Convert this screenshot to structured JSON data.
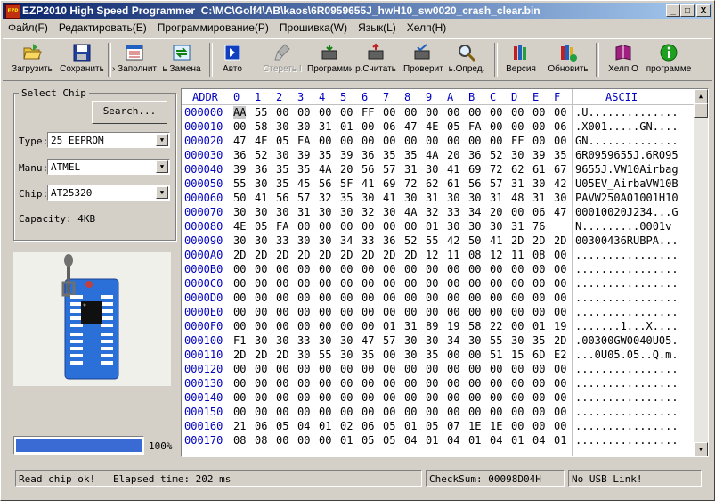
{
  "titlebar": {
    "app_name": "EZP2010 High Speed Programmer",
    "file_path": "C:\\MC\\Golf4\\AB\\kaos\\6R0959655J_hwH10_sw0020_crash_clear.bin",
    "minimize": "_",
    "maximize": "□",
    "close": "X"
  },
  "menu": [
    {
      "label": "Файл(F)"
    },
    {
      "label": "Редактировать(E)"
    },
    {
      "label": "Программирование(P)"
    },
    {
      "label": "Прошивка(W)"
    },
    {
      "label": "Язык(L)"
    },
    {
      "label": "Хелп(H)"
    }
  ],
  "toolbar": {
    "load": "Загрузить",
    "save": "Сохранить",
    "fill": "› Заполнит",
    "swap": "ь Замена",
    "auto": "Авто",
    "erase": "Стереть I",
    "program": "Программи",
    "read": "р.Считать",
    "verify": ".Проверит",
    "detect": "ь.Опред.",
    "version": "Версия",
    "update": "Обновить",
    "help": "Хелп О",
    "about": "программе"
  },
  "select_chip": {
    "legend": "Select Chip",
    "search_button": "Search...",
    "type_label": "Type:",
    "type_value": "25 EEPROM",
    "manu_label": "Manu:",
    "manu_value": "ATMEL",
    "chip_label": "Chip:",
    "chip_value": "AT25320",
    "capacity": "Capacity: 4KB"
  },
  "progress": {
    "value_fraction": 1.0,
    "percent_label": "100%"
  },
  "hex": {
    "addr_header": "ADDR",
    "ascii_header": "ASCII",
    "columns": [
      "0",
      "1",
      "2",
      "3",
      "4",
      "5",
      "6",
      "7",
      "8",
      "9",
      "A",
      "B",
      "C",
      "D",
      "E",
      "F"
    ],
    "rows": [
      {
        "addr": "000000",
        "bytes": [
          "AA",
          "55",
          "00",
          "00",
          "00",
          "00",
          "FF",
          "00",
          "00",
          "00",
          "00",
          "00",
          "00",
          "00",
          "00",
          "00"
        ],
        "ascii": ".U.............."
      },
      {
        "addr": "000010",
        "bytes": [
          "00",
          "58",
          "30",
          "30",
          "31",
          "01",
          "00",
          "06",
          "47",
          "4E",
          "05",
          "FA",
          "00",
          "00",
          "00",
          "06"
        ],
        "ascii": ".X001.....GN...."
      },
      {
        "addr": "000020",
        "bytes": [
          "47",
          "4E",
          "05",
          "FA",
          "00",
          "00",
          "00",
          "00",
          "00",
          "00",
          "00",
          "00",
          "00",
          "FF",
          "00",
          "00"
        ],
        "ascii": "GN.............."
      },
      {
        "addr": "000030",
        "bytes": [
          "36",
          "52",
          "30",
          "39",
          "35",
          "39",
          "36",
          "35",
          "35",
          "4A",
          "20",
          "36",
          "52",
          "30",
          "39",
          "35"
        ],
        "ascii": "6R0959655J.6R095"
      },
      {
        "addr": "000040",
        "bytes": [
          "39",
          "36",
          "35",
          "35",
          "4A",
          "20",
          "56",
          "57",
          "31",
          "30",
          "41",
          "69",
          "72",
          "62",
          "61",
          "67"
        ],
        "ascii": "9655J.VW10Airbag"
      },
      {
        "addr": "000050",
        "bytes": [
          "55",
          "30",
          "35",
          "45",
          "56",
          "5F",
          "41",
          "69",
          "72",
          "62",
          "61",
          "56",
          "57",
          "31",
          "30",
          "42"
        ],
        "ascii": "U05EV_AirbaVW10B"
      },
      {
        "addr": "000060",
        "bytes": [
          "50",
          "41",
          "56",
          "57",
          "32",
          "35",
          "30",
          "41",
          "30",
          "31",
          "30",
          "30",
          "31",
          "48",
          "31",
          "30"
        ],
        "ascii": "PAVW250A01001H10"
      },
      {
        "addr": "000070",
        "bytes": [
          "30",
          "30",
          "30",
          "31",
          "30",
          "30",
          "32",
          "30",
          "4A",
          "32",
          "33",
          "34",
          "20",
          "00",
          "06",
          "47"
        ],
        "ascii": "00010020J234...G"
      },
      {
        "addr": "000080",
        "bytes": [
          "4E",
          "05",
          "FA",
          "00",
          "00",
          "00",
          "00",
          "00",
          "00",
          "01",
          "30",
          "30",
          "30",
          "31",
          "76"
        ],
        "ascii": "N.........0001v"
      },
      {
        "addr": "000090",
        "bytes": [
          "30",
          "30",
          "33",
          "30",
          "30",
          "34",
          "33",
          "36",
          "52",
          "55",
          "42",
          "50",
          "41",
          "2D",
          "2D",
          "2D"
        ],
        "ascii": "00300436RUBPA..."
      },
      {
        "addr": "0000A0",
        "bytes": [
          "2D",
          "2D",
          "2D",
          "2D",
          "2D",
          "2D",
          "2D",
          "2D",
          "2D",
          "12",
          "11",
          "08",
          "12",
          "11",
          "08",
          "00"
        ],
        "ascii": "................"
      },
      {
        "addr": "0000B0",
        "bytes": [
          "00",
          "00",
          "00",
          "00",
          "00",
          "00",
          "00",
          "00",
          "00",
          "00",
          "00",
          "00",
          "00",
          "00",
          "00",
          "00"
        ],
        "ascii": "................"
      },
      {
        "addr": "0000C0",
        "bytes": [
          "00",
          "00",
          "00",
          "00",
          "00",
          "00",
          "00",
          "00",
          "00",
          "00",
          "00",
          "00",
          "00",
          "00",
          "00",
          "00"
        ],
        "ascii": "................"
      },
      {
        "addr": "0000D0",
        "bytes": [
          "00",
          "00",
          "00",
          "00",
          "00",
          "00",
          "00",
          "00",
          "00",
          "00",
          "00",
          "00",
          "00",
          "00",
          "00",
          "00"
        ],
        "ascii": "................"
      },
      {
        "addr": "0000E0",
        "bytes": [
          "00",
          "00",
          "00",
          "00",
          "00",
          "00",
          "00",
          "00",
          "00",
          "00",
          "00",
          "00",
          "00",
          "00",
          "00",
          "00"
        ],
        "ascii": "................"
      },
      {
        "addr": "0000F0",
        "bytes": [
          "00",
          "00",
          "00",
          "00",
          "00",
          "00",
          "00",
          "01",
          "31",
          "89",
          "19",
          "58",
          "22",
          "00",
          "01",
          "19"
        ],
        "ascii": ".......1...X...."
      },
      {
        "addr": "000100",
        "bytes": [
          "F1",
          "30",
          "30",
          "33",
          "30",
          "30",
          "47",
          "57",
          "30",
          "30",
          "34",
          "30",
          "55",
          "30",
          "35",
          "2D"
        ],
        "ascii": ".00300GW0040U05."
      },
      {
        "addr": "000110",
        "bytes": [
          "2D",
          "2D",
          "2D",
          "30",
          "55",
          "30",
          "35",
          "00",
          "30",
          "35",
          "00",
          "00",
          "51",
          "15",
          "6D",
          "E2"
        ],
        "ascii": "...0U05.05..Q.m."
      },
      {
        "addr": "000120",
        "bytes": [
          "00",
          "00",
          "00",
          "00",
          "00",
          "00",
          "00",
          "00",
          "00",
          "00",
          "00",
          "00",
          "00",
          "00",
          "00",
          "00"
        ],
        "ascii": "................"
      },
      {
        "addr": "000130",
        "bytes": [
          "00",
          "00",
          "00",
          "00",
          "00",
          "00",
          "00",
          "00",
          "00",
          "00",
          "00",
          "00",
          "00",
          "00",
          "00",
          "00"
        ],
        "ascii": "................"
      },
      {
        "addr": "000140",
        "bytes": [
          "00",
          "00",
          "00",
          "00",
          "00",
          "00",
          "00",
          "00",
          "00",
          "00",
          "00",
          "00",
          "00",
          "00",
          "00",
          "00"
        ],
        "ascii": "................"
      },
      {
        "addr": "000150",
        "bytes": [
          "00",
          "00",
          "00",
          "00",
          "00",
          "00",
          "00",
          "00",
          "00",
          "00",
          "00",
          "00",
          "00",
          "00",
          "00",
          "00"
        ],
        "ascii": "................"
      },
      {
        "addr": "000160",
        "bytes": [
          "21",
          "06",
          "05",
          "04",
          "01",
          "02",
          "06",
          "05",
          "01",
          "05",
          "07",
          "1E",
          "1E",
          "00",
          "00",
          "00"
        ],
        "ascii": "................"
      },
      {
        "addr": "000170",
        "bytes": [
          "08",
          "08",
          "00",
          "00",
          "00",
          "01",
          "05",
          "05",
          "04",
          "01",
          "04",
          "01",
          "04",
          "01",
          "04",
          "01"
        ],
        "ascii": "................"
      }
    ]
  },
  "status": {
    "message": "Read chip ok!",
    "elapsed": "Elapsed time: 202 ms",
    "checksum": "CheckSum: 00098D04H",
    "usb": "No USB Link!"
  },
  "colors": {
    "title_gradient_start": "#0a246a",
    "progress_fill": "#3a6ad4",
    "hex_address": "#0000c0",
    "chip_board": "#2a70d8"
  }
}
